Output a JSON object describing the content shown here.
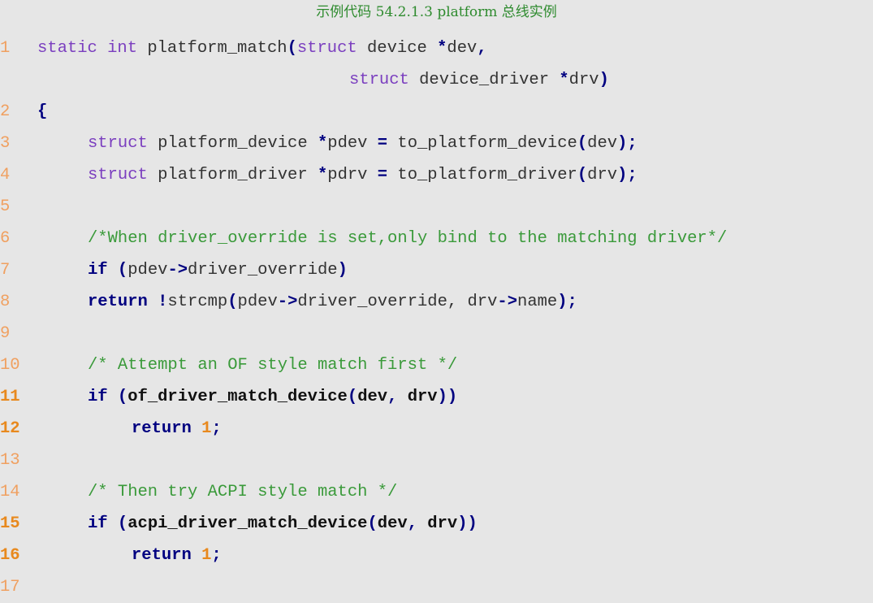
{
  "caption": "示例代码 54.2.1.3 platform 总线实例",
  "lines": [
    {
      "num": "1",
      "bold_num": false
    },
    {
      "num": "",
      "bold_num": false
    },
    {
      "num": "2",
      "bold_num": false
    },
    {
      "num": "3",
      "bold_num": false
    },
    {
      "num": "4",
      "bold_num": false
    },
    {
      "num": "5",
      "bold_num": false
    },
    {
      "num": "6",
      "bold_num": false
    },
    {
      "num": "7",
      "bold_num": false
    },
    {
      "num": "8",
      "bold_num": false
    },
    {
      "num": "9",
      "bold_num": false
    },
    {
      "num": "10",
      "bold_num": false
    },
    {
      "num": "11",
      "bold_num": true
    },
    {
      "num": "12",
      "bold_num": true
    },
    {
      "num": "13",
      "bold_num": false
    },
    {
      "num": "14",
      "bold_num": false
    },
    {
      "num": "15",
      "bold_num": true
    },
    {
      "num": "16",
      "bold_num": true
    },
    {
      "num": "17",
      "bold_num": false
    }
  ],
  "tokens": {
    "l1": {
      "t1": "static int",
      "t2": " platform_match",
      "t3": "(",
      "t4": "struct",
      "t5": " device ",
      "t6": "*",
      "t7": "dev",
      "t8": ","
    },
    "l1b": {
      "t1": "struct",
      "t2": " device_driver ",
      "t3": "*",
      "t4": "drv",
      "t5": ")"
    },
    "l2": {
      "t1": "{"
    },
    "l3": {
      "t1": "struct",
      "t2": " platform_device ",
      "t3": "*",
      "t4": "pdev ",
      "t5": "=",
      "t6": " to_platform_device",
      "t7": "(",
      "t8": "dev",
      "t9": ");"
    },
    "l4": {
      "t1": "struct",
      "t2": " platform_driver ",
      "t3": "*",
      "t4": "pdrv ",
      "t5": "=",
      "t6": " to_platform_driver",
      "t7": "(",
      "t8": "drv",
      "t9": ");"
    },
    "l6": {
      "t1": "/*When driver_override is set,only bind to the matching driver*/"
    },
    "l7": {
      "t1": "if",
      "t2": " (",
      "t3": "pdev",
      "t4": "->",
      "t5": "driver_override",
      "t6": ")"
    },
    "l8": {
      "t1": "return",
      "t2": " !",
      "t3": "strcmp",
      "t4": "(",
      "t5": "pdev",
      "t6": "->",
      "t7": "driver_override, drv",
      "t8": "->",
      "t9": "name",
      "t10": ");"
    },
    "l10": {
      "t1": "/* Attempt an OF style match first */"
    },
    "l11": {
      "t1": "if",
      "t2": " (",
      "t3": "of_driver_match_device",
      "t4": "(",
      "t5": "dev",
      "t6": ",",
      "t7": " drv",
      "t8": "))"
    },
    "l12": {
      "t1": "return",
      "t2": " 1",
      "t3": ";"
    },
    "l14": {
      "t1": "/* Then try ACPI style match */"
    },
    "l15": {
      "t1": "if",
      "t2": " (",
      "t3": "acpi_driver_match_device",
      "t4": "(",
      "t5": "dev",
      "t6": ",",
      "t7": " drv",
      "t8": "))"
    },
    "l16": {
      "t1": "return",
      "t2": " 1",
      "t3": ";"
    }
  }
}
